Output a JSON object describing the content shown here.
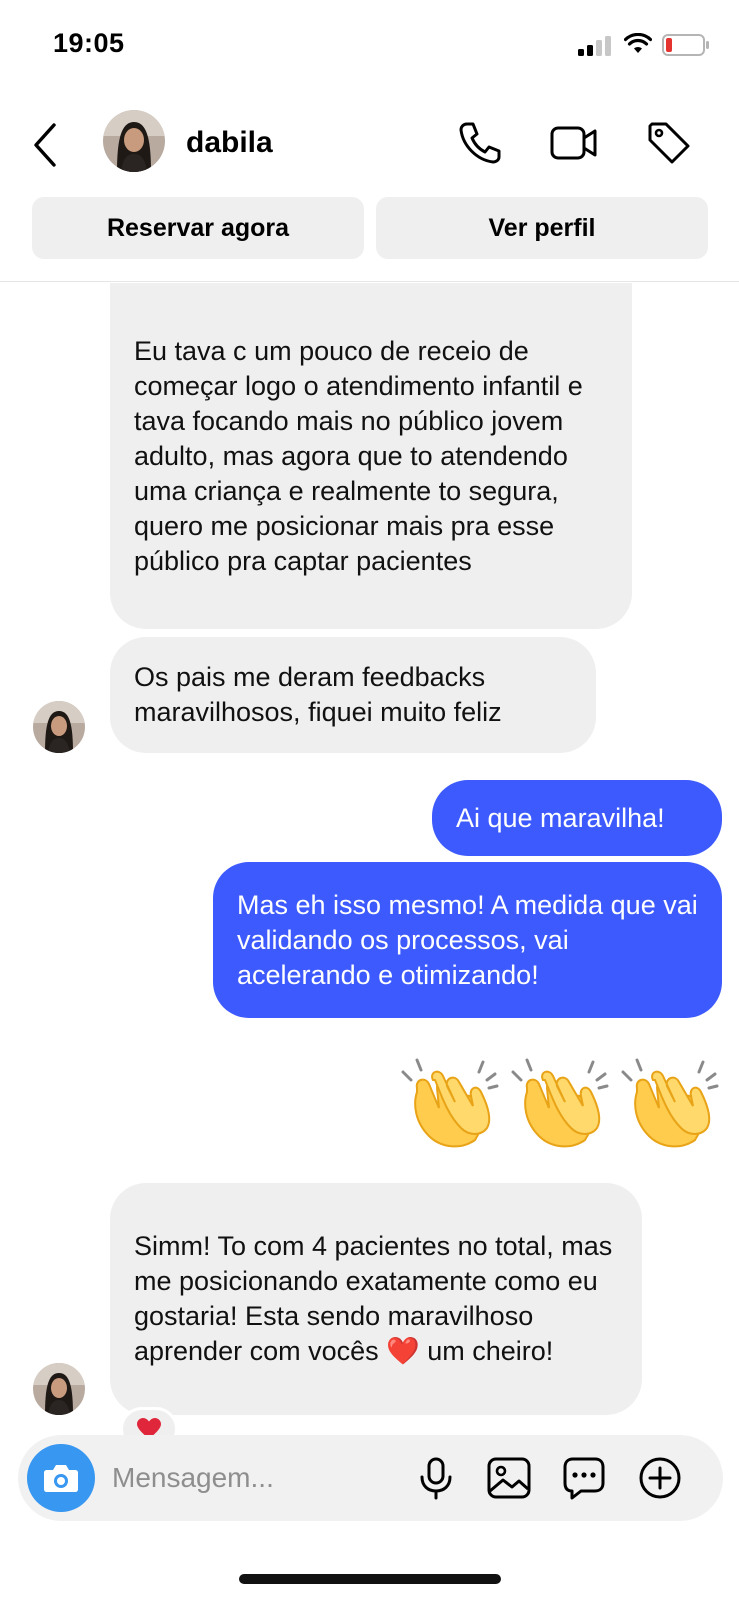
{
  "status_bar": {
    "time": "19:05"
  },
  "header": {
    "contact_name": "dabila"
  },
  "actions": {
    "book_label": "Reservar agora",
    "profile_label": "Ver perfil"
  },
  "messages": [
    {
      "direction": "in",
      "text": "Eu tava c um pouco de receio de começar logo o atendimento infantil e tava focando mais no público jovem adulto, mas agora que to atendendo uma criança e realmente to segura, quero me posicionar mais pra esse público pra captar pacientes"
    },
    {
      "direction": "in",
      "text": "Os pais me deram feedbacks maravilhosos, fiquei muito feliz"
    },
    {
      "direction": "out",
      "text": "Ai que maravilha!"
    },
    {
      "direction": "out",
      "text": "Mas eh isso mesmo! A medida que vai validando os processos, vai acelerando e otimizando!"
    },
    {
      "direction": "out",
      "text": "👏👏👏"
    },
    {
      "direction": "in",
      "text": "Simm! To com 4 pacientes no total, mas me posicionando exatamente como eu gostaria! Esta sendo maravilhoso aprender com vocês ❤️ um cheiro!"
    }
  ],
  "composer": {
    "placeholder": "Mensagem..."
  },
  "colors": {
    "outgoing_bubble": "#3d5afe",
    "incoming_bubble": "#efefef",
    "camera_button": "#3897f0"
  }
}
